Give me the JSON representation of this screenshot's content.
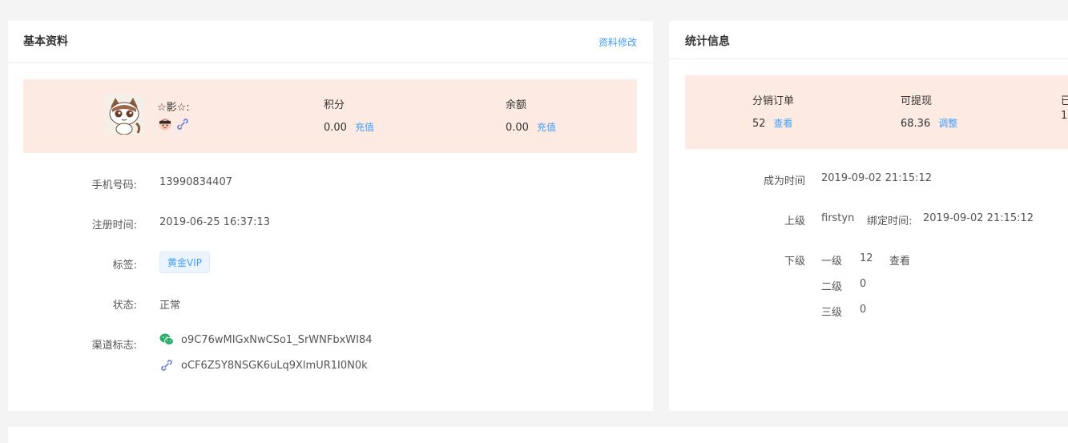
{
  "basic": {
    "title": "基本资料",
    "edit_link": "资料修改",
    "nickname": "☆影☆:",
    "points_label": "积分",
    "points_value": "0.00",
    "points_action": "充值",
    "balance_label": "余额",
    "balance_value": "0.00",
    "balance_action": "充值",
    "phone_label": "手机号码:",
    "phone_value": "13990834407",
    "reg_label": "注册时间:",
    "reg_value": "2019-06-25 16:37:13",
    "tag_label": "标签:",
    "tag_value": "黄金VIP",
    "status_label": "状态:",
    "status_value": "正常",
    "channel_label": "渠道标志:",
    "channels": [
      {
        "icon": "wechat-icon",
        "value": "o9C76wMIGxNwCSo1_SrWNFbxWI84"
      },
      {
        "icon": "link-icon",
        "value": "oCF6Z5Y8NSGK6uLq9XlmUR1I0N0k"
      }
    ]
  },
  "stats": {
    "title": "统计信息",
    "orders_label": "分销订单",
    "orders_value": "52",
    "orders_action": "查看",
    "withdraw_label": "可提现",
    "withdraw_value": "68.36",
    "withdraw_action": "调整",
    "third_label_partial": "已",
    "third_value_partial": "1",
    "joined_label": "成为时间",
    "joined_value": "2019-09-02 21:15:12",
    "parent_label": "上级",
    "parent_value": "firstyn",
    "bind_label": "绑定时间:",
    "bind_value": "2019-09-02 21:15:12",
    "sub_label": "下级",
    "levels": [
      {
        "name": "一级",
        "count": "12",
        "action": "查看"
      },
      {
        "name": "二级",
        "count": "0"
      },
      {
        "name": "三级",
        "count": "0"
      }
    ]
  },
  "colors": {
    "accent": "#409eff",
    "banner_bg": "#fdebe3",
    "wechat": "#2aae67",
    "link_icon": "#6b7fd7"
  }
}
